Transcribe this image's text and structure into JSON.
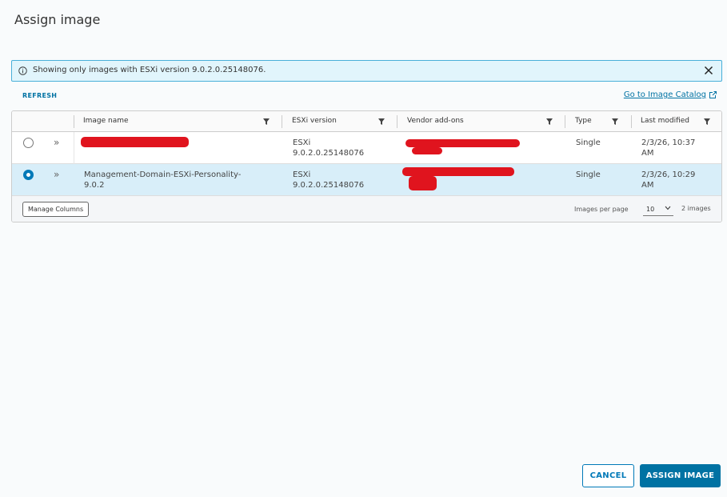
{
  "dialog": {
    "title": "Assign image"
  },
  "banner": {
    "text": "Showing only images with ESXi version 9.0.2.0.25148076.",
    "icon": "info-icon",
    "close_icon": "close-icon"
  },
  "toolbar": {
    "refresh_label": "REFRESH",
    "catalog_link_label": "Go to Image Catalog"
  },
  "grid": {
    "columns": [
      {
        "label": "Image name"
      },
      {
        "label": "ESXi version"
      },
      {
        "label": "Vendor add-ons"
      },
      {
        "label": "Type"
      },
      {
        "label": "Last modified"
      }
    ],
    "rows": [
      {
        "selected": false,
        "image_name_line1": "",
        "image_name_line2": "",
        "esxi_line1": "ESXi",
        "esxi_line2": "9.0.2.0.25148076",
        "type": "Single",
        "modified_line1": "2/3/26, 10:37",
        "modified_line2": "AM"
      },
      {
        "selected": true,
        "image_name_line1": "Management-Domain-ESXi-Personality-",
        "image_name_line2": "9.0.2",
        "esxi_line1": "ESXi",
        "esxi_line2": "9.0.2.0.25148076",
        "type": "Single",
        "modified_line1": "2/3/26, 10:29",
        "modified_line2": "AM"
      }
    ],
    "footer": {
      "manage_columns_label": "Manage Columns",
      "per_page_label": "Images per page",
      "per_page_value": "10",
      "count_label": "2 images"
    }
  },
  "actions": {
    "cancel_label": "CANCEL",
    "assign_label": "ASSIGN IMAGE"
  },
  "colors": {
    "accent": "#0072a3",
    "banner_bg": "#e1f5fc",
    "banner_border": "#49afd9",
    "selected_row": "#d8eef9",
    "redaction": "#e0141e"
  }
}
